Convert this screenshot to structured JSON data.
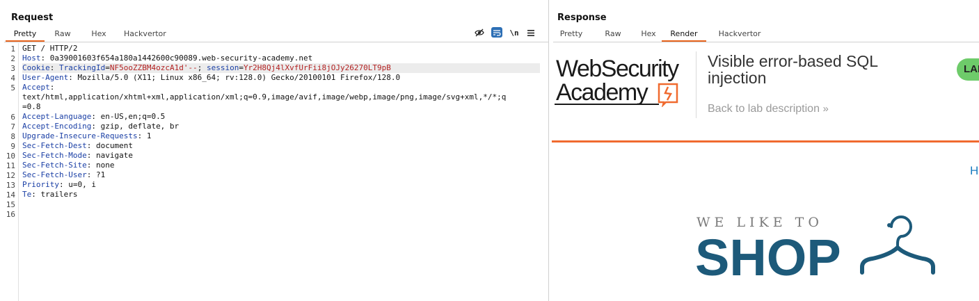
{
  "request": {
    "title": "Request",
    "tabs": [
      "Pretty",
      "Raw",
      "Hex",
      "Hackvertor"
    ],
    "active_tab": "Pretty",
    "toolbar": {
      "hide_icon": "eye-off-icon",
      "wrap_icon": "wrap-lines-icon",
      "newline_label": "\\n",
      "menu_icon": "hamburger-menu-icon"
    },
    "line_numbers": [
      "1",
      "2",
      "3",
      "4",
      "5",
      "",
      "",
      "6",
      "7",
      "8",
      "9",
      "10",
      "11",
      "12",
      "13",
      "14",
      "15",
      "16"
    ],
    "lines": [
      {
        "text": "GET / HTTP/2"
      },
      {
        "header": "Host",
        "value": "0a39001603f654a180a1442600c90089.web-security-academy.net"
      },
      {
        "header": "Cookie",
        "cookie_name1": "TrackingId",
        "cookie_val1": "NF5ooZZBM4ozcA1d'--",
        "cookie_name2": "session",
        "cookie_val2": "Yr2H8Qj4lXvfUrFii8jOJy26270LT9pB"
      },
      {
        "header": "User-Agent",
        "value": "Mozilla/5.0 (X11; Linux x86_64; rv:128.0) Gecko/20100101 Firefox/128.0"
      },
      {
        "header": "Accept",
        "value": ""
      },
      {
        "text": "text/html,application/xhtml+xml,application/xml;q=0.9,image/avif,image/webp,image/png,image/svg+xml,*/*;q"
      },
      {
        "text": "=0.8"
      },
      {
        "header": "Accept-Language",
        "value": "en-US,en;q=0.5"
      },
      {
        "header": "Accept-Encoding",
        "value": "gzip, deflate, br"
      },
      {
        "header": "Upgrade-Insecure-Requests",
        "value": "1"
      },
      {
        "header": "Sec-Fetch-Dest",
        "value": "document"
      },
      {
        "header": "Sec-Fetch-Mode",
        "value": "navigate"
      },
      {
        "header": "Sec-Fetch-Site",
        "value": "none"
      },
      {
        "header": "Sec-Fetch-User",
        "value": "?1"
      },
      {
        "header": "Priority",
        "value": "u=0, i"
      },
      {
        "header": "Te",
        "value": "trailers"
      },
      {
        "text": ""
      },
      {
        "text": ""
      }
    ]
  },
  "response": {
    "title": "Response",
    "tabs": [
      "Pretty",
      "Raw",
      "Hex",
      "Render",
      "Hackvertor"
    ],
    "active_tab": "Render",
    "render": {
      "brand_line1": "WebSecurity",
      "brand_line2": "Academy",
      "lab_title": "Visible error-based SQL injection",
      "back_link": "Back to lab description",
      "badge": "LAB",
      "home_link": "Home",
      "shop_tagline": "WE LIKE TO",
      "shop_word": "SHOP",
      "accent_color": "#f06a2f",
      "shop_color": "#1d5a7a"
    }
  }
}
